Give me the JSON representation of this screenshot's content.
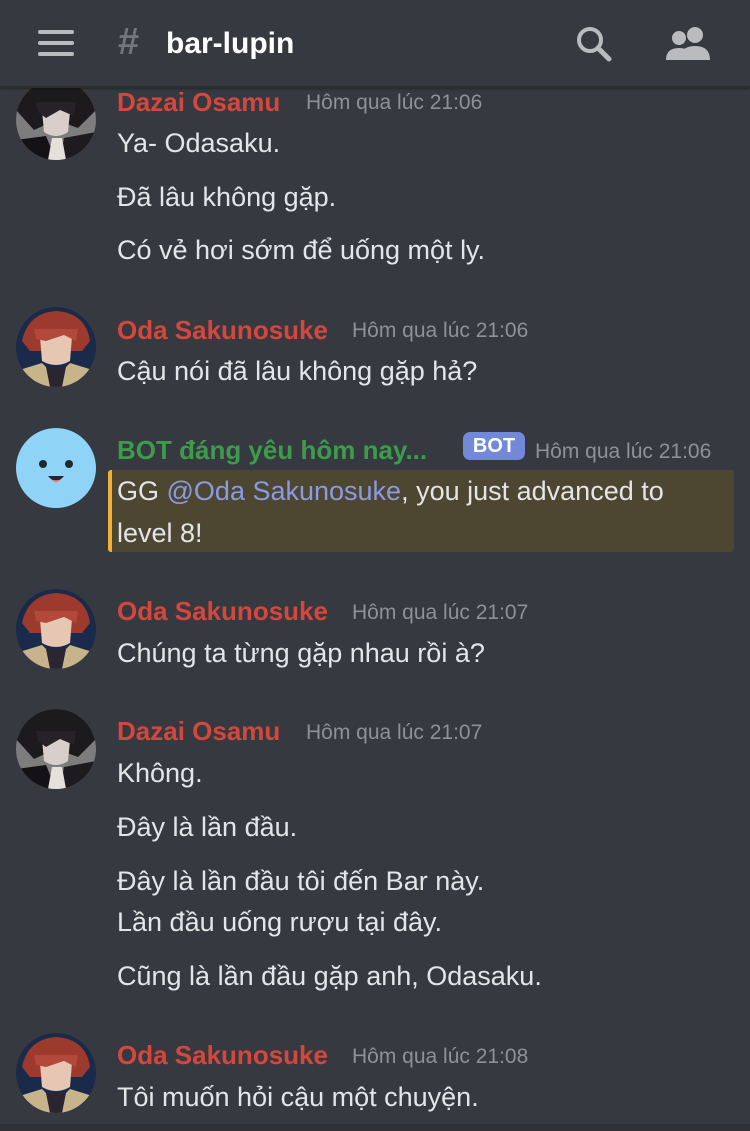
{
  "header": {
    "hash": "#",
    "channel": "bar-lupin",
    "menu_icon": "hamburger-menu-icon",
    "search_icon": "search-icon",
    "members_icon": "members-icon"
  },
  "colors": {
    "background": "#36393f",
    "username_red": "#d5473d",
    "username_green": "#3d9b4b",
    "bot_badge": "#7289da",
    "mention_bg": "#4d4631",
    "mention_bar": "#f0b132",
    "mention_text": "#8a9be6"
  },
  "messages": [
    {
      "author": "Dazai Osamu",
      "time": "Hôm qua lúc 21:06",
      "lines": [
        "Ya- Odasaku.",
        "Đã lâu không gặp.",
        "Có vẻ hơi sớm để uống một ly."
      ]
    },
    {
      "author": "Oda Sakunosuke",
      "time": "Hôm qua lúc 21:06",
      "lines": [
        "Cậu nói đã lâu không gặp hả?"
      ]
    },
    {
      "author": "BOT đáng yêu hôm nay...",
      "badge": "BOT",
      "time": "Hôm qua lúc 21:06",
      "mention_prefix": "GG ",
      "mention": "@Oda Sakunosuke",
      "mention_suffix": ", you just advanced to",
      "mention_line2": "level 8!"
    },
    {
      "author": "Oda Sakunosuke",
      "time": "Hôm qua lúc 21:07",
      "lines": [
        "Chúng ta từng gặp nhau rồi à?"
      ]
    },
    {
      "author": "Dazai Osamu",
      "time": "Hôm qua lúc 21:07",
      "lines": [
        "Không.",
        "Đây là lần đầu.",
        "Đây là lần đầu tôi đến Bar này.",
        "Lần đầu uống rượu tại đây.",
        "Cũng là lần đầu gặp anh, Odasaku."
      ]
    },
    {
      "author": "Oda Sakunosuke",
      "time": "Hôm qua lúc 21:08",
      "lines": [
        "Tôi muốn hỏi cậu một chuyện."
      ]
    }
  ]
}
